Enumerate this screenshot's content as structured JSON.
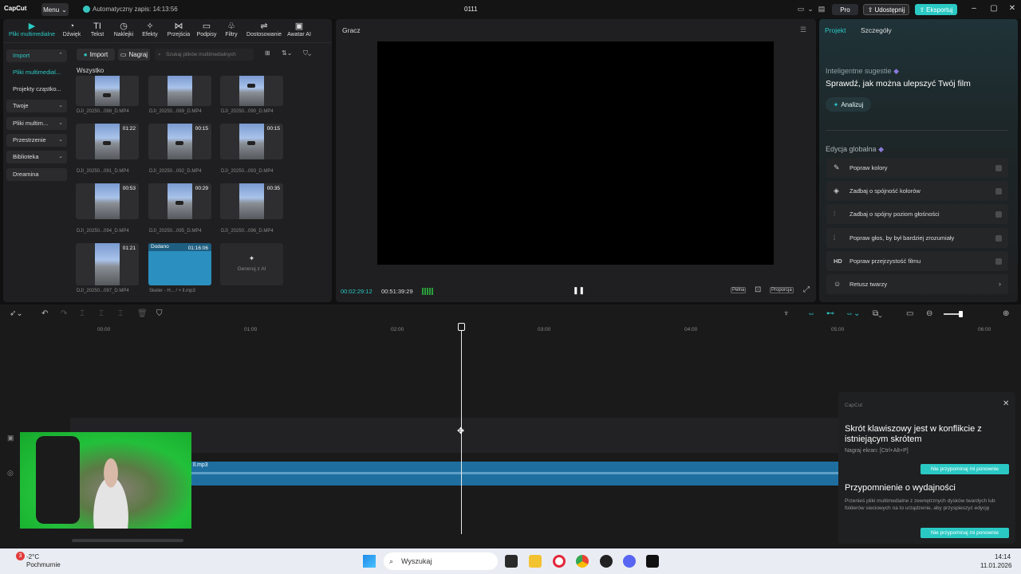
{
  "app": {
    "logo": "CapCut",
    "menu_label": "Menu",
    "autosave": "Automatyczny zapis: 14:13:56",
    "project_title": "0111"
  },
  "header": {
    "pro_label": "Pro",
    "share_label": "Udostępnij",
    "export_label": "Eksportuj"
  },
  "media_toolbar": {
    "tabs": [
      {
        "label": "Pliki multimedialne",
        "icon": "media-icon"
      },
      {
        "label": "Dźwięk",
        "icon": "audio-icon"
      },
      {
        "label": "Tekst",
        "icon": "text-icon"
      },
      {
        "label": "Naklejki",
        "icon": "sticker-icon"
      },
      {
        "label": "Efekty",
        "icon": "effects-icon"
      },
      {
        "label": "Przejścia",
        "icon": "transitions-icon"
      },
      {
        "label": "Podpisy",
        "icon": "captions-icon"
      },
      {
        "label": "Filtry",
        "icon": "filters-icon"
      },
      {
        "label": "Dostosowanie",
        "icon": "adjust-icon"
      },
      {
        "label": "Awatar AI",
        "icon": "avatar-icon"
      }
    ]
  },
  "side_nav": {
    "items": [
      {
        "label": "Import"
      },
      {
        "label": "Pliki multimedial..."
      },
      {
        "label": "Projekty cząstko..."
      },
      {
        "label": "Twoje"
      },
      {
        "label": "Pliki multim..."
      },
      {
        "label": "Przestrzenie"
      },
      {
        "label": "Biblioteka"
      },
      {
        "label": "Dreamina"
      }
    ]
  },
  "media": {
    "import_label": "Import",
    "record_label": "Nagraj",
    "search_placeholder": "Szukaj plików multimedialnych",
    "filter_label": "Wszystko",
    "items": [
      {
        "name": "DJI_20250...088_D.MP4",
        "duration": ""
      },
      {
        "name": "DJI_20250...089_D.MP4",
        "duration": ""
      },
      {
        "name": "DJI_20250...090_D.MP4",
        "duration": ""
      },
      {
        "name": "DJI_20250...091_D.MP4",
        "duration": "01:22"
      },
      {
        "name": "DJI_20250...092_D.MP4",
        "duration": "00:15"
      },
      {
        "name": "DJI_20250...093_D.MP4",
        "duration": "00:15"
      },
      {
        "name": "DJI_20250...094_D.MP4",
        "duration": "00:53"
      },
      {
        "name": "DJI_20250...095_D.MP4",
        "duration": "00:29"
      },
      {
        "name": "DJI_20250...096_D.MP4",
        "duration": "00:35"
      },
      {
        "name": "DJI_20250...097_D.MP4",
        "duration": "01:21"
      },
      {
        "name": "Skeler - H... / + ll.mp3",
        "duration": "01:16:06",
        "added": "Dodano"
      }
    ],
    "generate_label": "Generuj z AI"
  },
  "player": {
    "title": "Gracz",
    "current_time": "00:02:29:12",
    "total_time": "00:51:39:29",
    "full_label": "Pełna",
    "ratio_label": "Proporcja"
  },
  "right_panel": {
    "tab_project": "Projekt",
    "tab_details": "Szczegóły",
    "smart_title": "Inteligentne sugestie",
    "smart_sub": "Sprawdź, jak można ulepszyć Twój film",
    "analyze_label": "Analizuj",
    "global_title": "Edycja globalna",
    "global_items": [
      {
        "label": "Popraw kolory",
        "icon": "wand-icon"
      },
      {
        "label": "Zadbaj o spójność kolorów",
        "icon": "palette-icon"
      },
      {
        "label": "Zadbaj o spójny poziom głośności",
        "icon": "sliders-icon"
      },
      {
        "label": "Popraw głos, by był bardziej zrozumiały",
        "icon": "voice-icon"
      },
      {
        "label": "Popraw przejrzystość filmu",
        "icon": "hd-icon",
        "icon_text": "HD"
      },
      {
        "label": "Retusz twarzy",
        "icon": "face-icon"
      }
    ]
  },
  "timeline": {
    "ruler": [
      "00:00",
      "01:00",
      "02:00",
      "03:00",
      "04:00",
      "05:00",
      "06:00"
    ],
    "audio_clip_label": "ll.mp3"
  },
  "notification": {
    "app": "CapCut",
    "n1_title": "Skrót klawiszowy jest w konflikcie z istniejącym skrótem",
    "n1_sub": "Nagraj ekran: [Ctrl+Alt+P]",
    "n1_btn": "Nie przypominaj mi ponownie",
    "n2_title": "Przypomnienie o wydajności",
    "n2_body": "Przenieś pliki multimedialne z zewnętrznych dysków twardych lub folderów sieciowych na to urządzenie, aby przyspieszyć edycję",
    "n2_btn": "Nie przypominaj mi ponownie"
  },
  "taskbar": {
    "weather_badge": "3",
    "weather_temp": "-2°C",
    "weather_desc": "Pochmurnie",
    "search_label": "Wyszukaj",
    "time": "14:14",
    "date": "11.01.2026"
  },
  "colors": {
    "accent": "#2ac9c4",
    "panel": "#1f1f21",
    "audio_clip": "#1e6fa0"
  }
}
